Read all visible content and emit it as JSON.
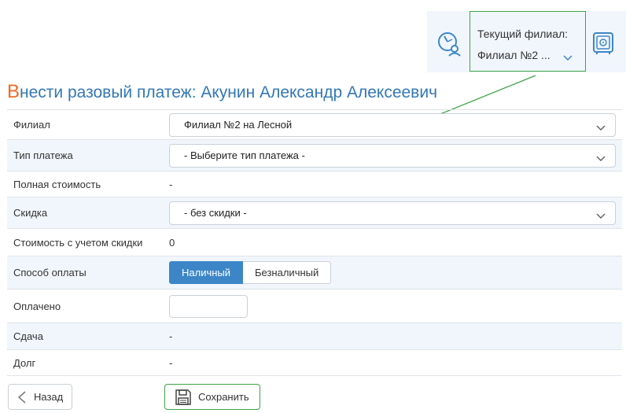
{
  "header": {
    "branch_caption": "Текущий филиал:",
    "branch_value": "Филиал №2 ...",
    "colors": {
      "highlight_border": "#3fa548",
      "bar_bg": "#f0f6fc"
    }
  },
  "page": {
    "title_first_letter": "В",
    "title_rest": "нести разовый платеж: Акунин Александр Алексеевич"
  },
  "form": {
    "branch_label": "Филиал",
    "branch_value": "Филиал №2 на Лесной",
    "payment_type_label": "Тип платежа",
    "payment_type_value": "- Выберите тип платежа -",
    "full_cost_label": "Полная стоимость",
    "full_cost_value": "-",
    "discount_label": "Скидка",
    "discount_value": "- без скидки -",
    "discounted_cost_label": "Стоимость с учетом скидки",
    "discounted_cost_value": "0",
    "payment_method_label": "Способ оплаты",
    "payment_methods": [
      "Наличный",
      "Безналичный"
    ],
    "paid_label": "Оплачено",
    "paid_value": "",
    "change_label": "Сдача",
    "change_value": "-",
    "debt_label": "Долг",
    "debt_value": "-"
  },
  "actions": {
    "back_label": "Назад",
    "save_label": "Сохранить"
  },
  "colors": {
    "title": "#3278b5",
    "title_accent": "#f26a21",
    "primary": "#3c86c8",
    "debt_value": "#d9534f",
    "annotation_arrow": "#3fa548"
  }
}
